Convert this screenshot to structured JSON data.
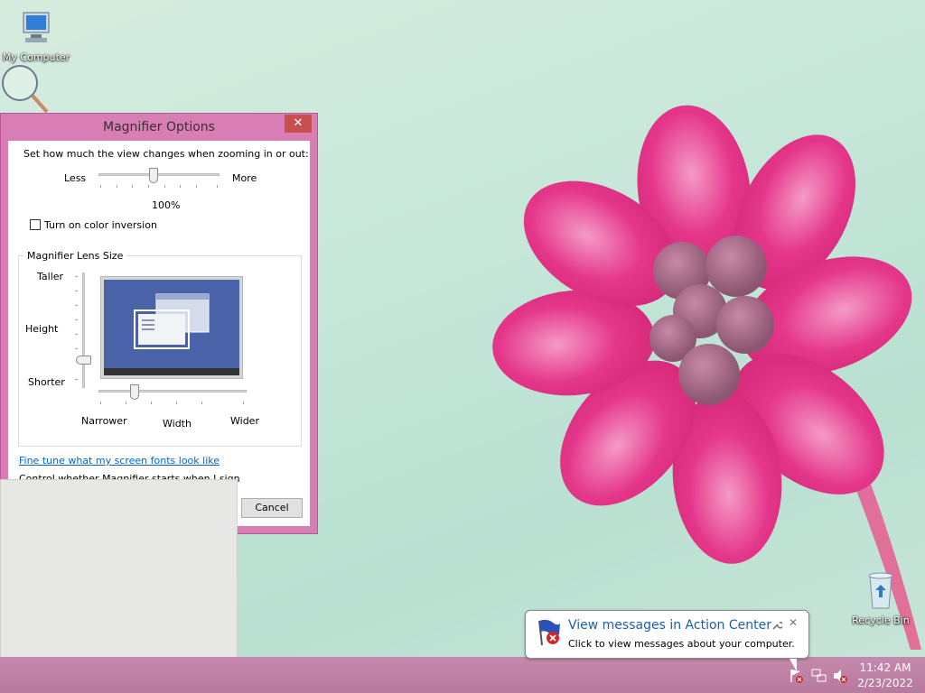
{
  "desktop": {
    "icons": {
      "my_computer": "My Computer",
      "recycle_bin": "Recycle Bin"
    }
  },
  "dialog": {
    "title": "Magnifier Options",
    "close_glyph": "✕",
    "zoom_prompt": "Set how much the view changes when zooming in or out:",
    "zoom_less": "Less",
    "zoom_more": "More",
    "zoom_value": "100%",
    "zoom_level": 0.45,
    "color_inversion_label": "Turn on color inversion",
    "color_inversion_checked": false,
    "lens_group_title": "Magnifier Lens Size",
    "height_taller": "Taller",
    "height_label": "Height",
    "height_shorter": "Shorter",
    "width_narrower": "Narrower",
    "width_label": "Width",
    "width_wider": "Wider",
    "fine_tune_link": "Fine tune what my screen fonts look like",
    "partial_link": "Control whether Magnifier starts when I sign in",
    "cancel_button": "Cancel"
  },
  "notification": {
    "title": "View messages in Action Center",
    "body": "Click to view messages about your computer.",
    "close_glyph": "✕"
  },
  "taskbar": {
    "time": "11:42 AM",
    "date": "2/23/2022"
  },
  "colors": {
    "dialog_frame": "#d87eb4",
    "close_button": "#c7504f",
    "link": "#0066cc",
    "taskbar": "#b77a9e",
    "notification_title": "#1c5fa8"
  }
}
